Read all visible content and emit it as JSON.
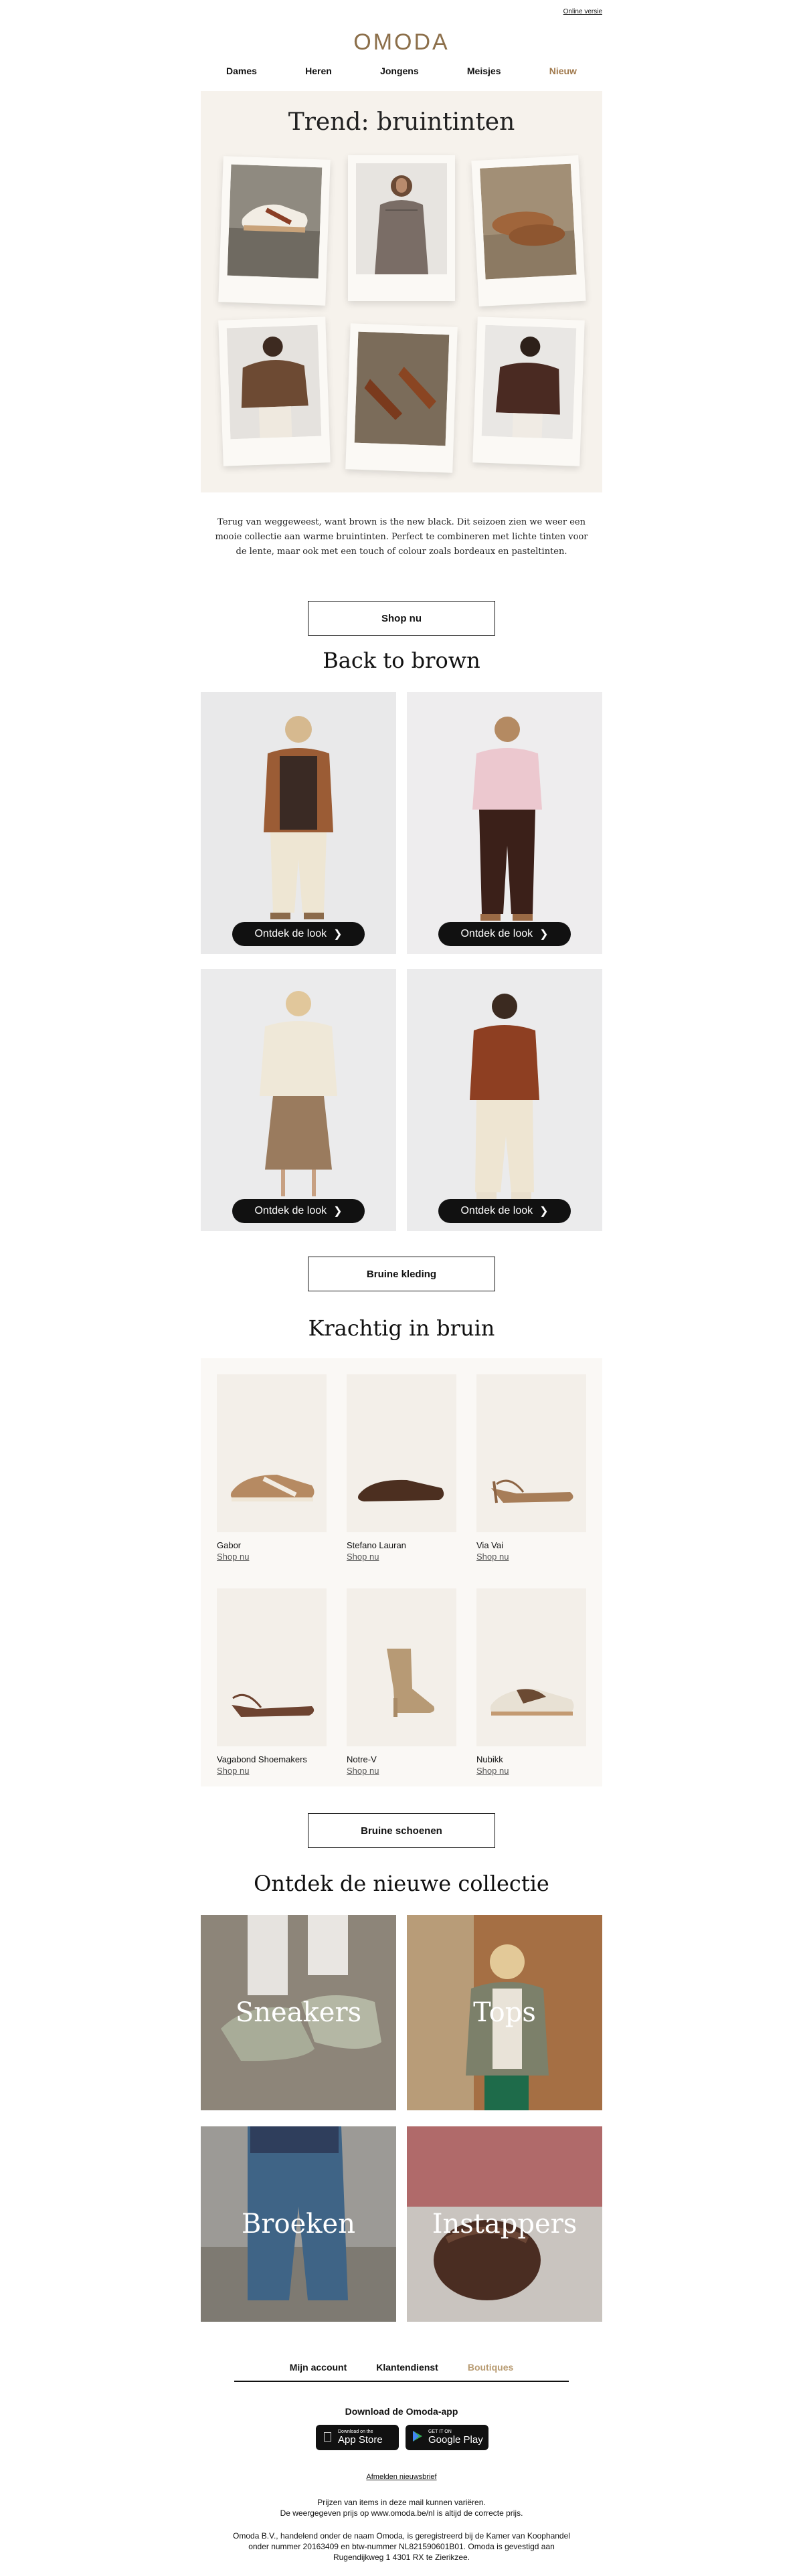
{
  "header": {
    "online_version": "Online versie",
    "logo": "OMODA"
  },
  "nav": {
    "items": [
      "Dames",
      "Heren",
      "Jongens",
      "Meisjes",
      "Nieuw"
    ]
  },
  "hero": {
    "title": "Trend: bruintinten"
  },
  "intro": {
    "text": "Terug van weggeweest, want brown is the new black. Dit seizoen zien we weer een mooie collectie aan warme bruintinten. Perfect te combineren met lichte tinten voor de lente, maar ook met een touch of colour zoals bordeaux en pasteltinten."
  },
  "buttons": {
    "shop_now": "Shop nu",
    "brown_clothing": "Bruine kleding",
    "brown_shoes": "Bruine schoenen"
  },
  "looks": {
    "title": "Back to brown",
    "cta": "Ontdek de look"
  },
  "shoes": {
    "title": "Krachtig in bruin",
    "link": "Shop nu",
    "items": [
      {
        "brand": "Gabor"
      },
      {
        "brand": "Stefano Lauran"
      },
      {
        "brand": "Via Vai"
      },
      {
        "brand": "Vagabond Shoemakers"
      },
      {
        "brand": "Notre-V"
      },
      {
        "brand": "Nubikk"
      }
    ]
  },
  "collection": {
    "title": "Ontdek de nieuwe collectie",
    "categories": [
      "Sneakers",
      "Tops",
      "Broeken",
      "Instappers"
    ]
  },
  "footer": {
    "links": [
      "Mijn account",
      "Klantendienst",
      "Boutiques"
    ],
    "app_title": "Download de Omoda-app",
    "appstore_small": "Download on the",
    "appstore_big": "App Store",
    "googleplay_small": "GET IT ON",
    "googleplay_big": "Google Play",
    "unsubscribe": "Afmelden nieuwsbrief",
    "prices_line1": "Prijzen van items in deze mail kunnen variëren.",
    "prices_line2": "De weergegeven prijs op www.omoda.be/nl is altijd de correcte prijs.",
    "legal": "Omoda B.V., handelend onder de naam Omoda, is geregistreerd bij de Kamer van Koophandel onder nummer 20163409 en btw-nummer NL821590601B01. Omoda is gevestigd aan Rugendijkweg 1 4301 RX te Zierikzee."
  },
  "colors": {
    "accent": "#a0794c",
    "hero_bg": "#f6f2ec",
    "button_dark": "#111111"
  }
}
